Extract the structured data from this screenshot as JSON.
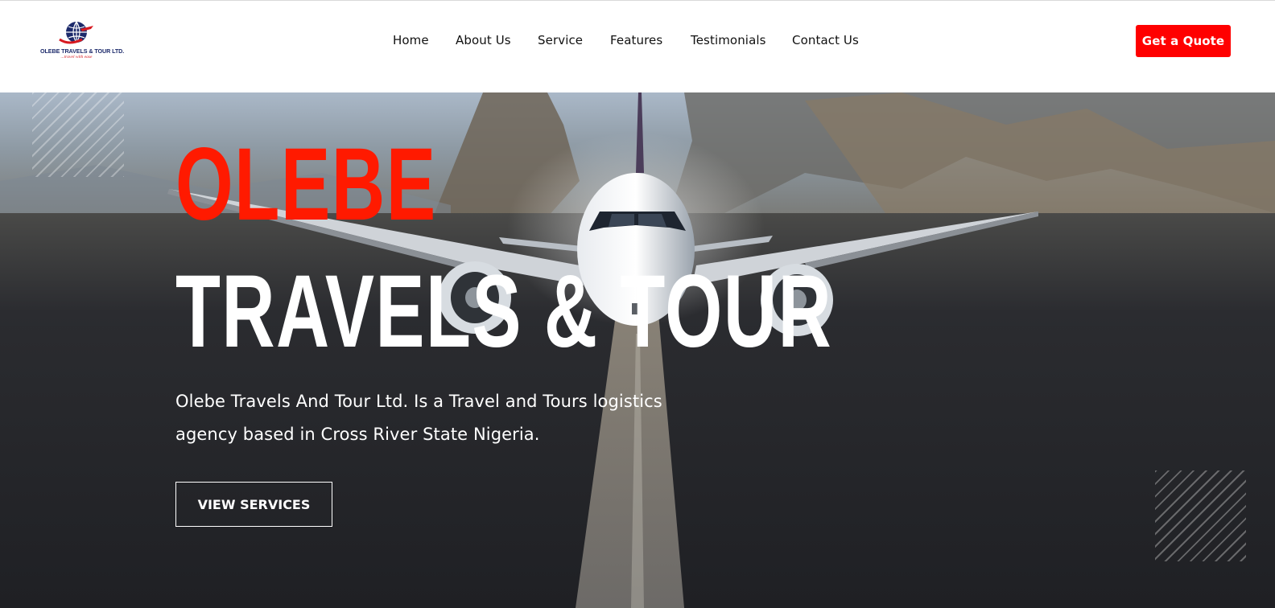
{
  "header": {
    "logo": {
      "name": "OLEBE TRAVELS & TOUR LTD.",
      "tagline": "...travel with ease",
      "icon": "globe-plane-logo",
      "colors": {
        "navy": "#1c2a6b",
        "red": "#d71920"
      }
    },
    "nav": [
      {
        "label": "Home"
      },
      {
        "label": "About Us"
      },
      {
        "label": "Service"
      },
      {
        "label": "Features"
      },
      {
        "label": "Testimonials"
      },
      {
        "label": "Contact Us"
      }
    ],
    "cta_label": "Get a Quote"
  },
  "hero": {
    "title_line1": "OLEBE",
    "title_line2": "TRAVELS & TOUR",
    "description": "Olebe Travels And Tour Ltd. Is a Travel and Tours logistics agency based in Cross River State Nigeria.",
    "button_label": "VIEW SERVICES",
    "background": "airplane-runway-photo"
  },
  "colors": {
    "accent": "#ff0000",
    "title_red": "#ff1a00",
    "text_dark": "#111111",
    "white": "#ffffff"
  }
}
